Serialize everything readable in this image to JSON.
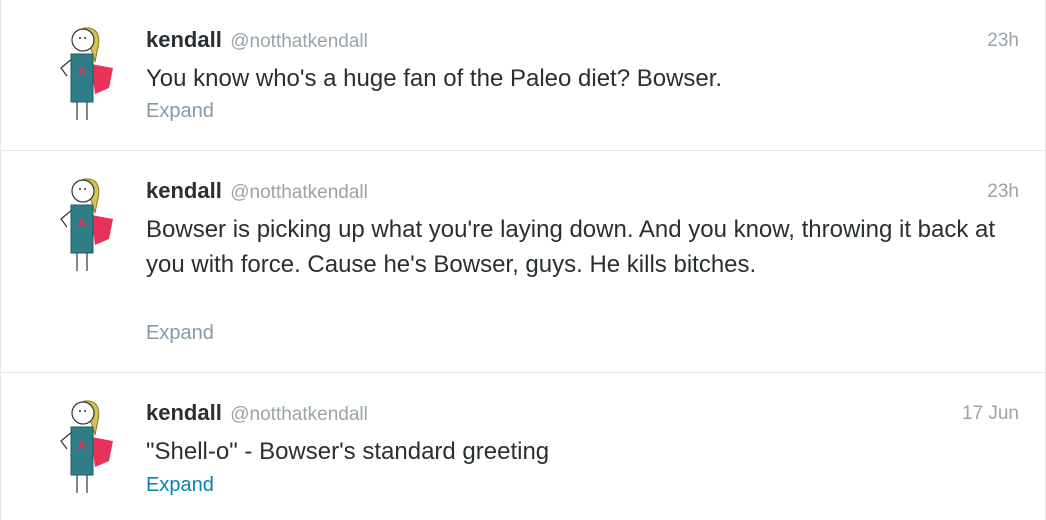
{
  "colors": {
    "name": "#292f33",
    "meta": "#99a4aa",
    "expand_muted": "#8899a6",
    "expand_link": "#0084b4",
    "cape": "#e8325a",
    "shirt": "#2f7d86",
    "hair": "#d6c15a"
  },
  "tweets": [
    {
      "fullname": "kendall",
      "username": "@notthatkendall",
      "time": "23h",
      "text": "You know who's a huge fan of the Paleo diet? Bowser.",
      "expand": "Expand",
      "avatar_icon": "stick-figure-hero-avatar-icon"
    },
    {
      "fullname": "kendall",
      "username": "@notthatkendall",
      "time": "23h",
      "text": "Bowser is picking up what you're laying down. And you know, throwing it back at you with force. Cause he's Bowser, guys. He kills bitches.",
      "expand": "Expand",
      "avatar_icon": "stick-figure-hero-avatar-icon"
    },
    {
      "fullname": "kendall",
      "username": "@notthatkendall",
      "time": "17 Jun",
      "text": "\"Shell-o\" - Bowser's standard greeting",
      "expand": "Expand",
      "avatar_icon": "stick-figure-hero-avatar-icon"
    }
  ]
}
